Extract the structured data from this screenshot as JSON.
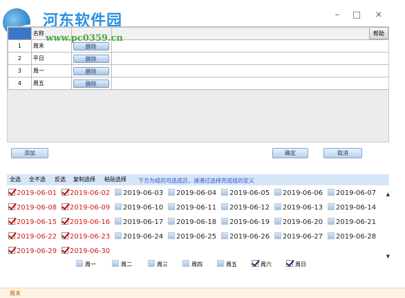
{
  "watermark": {
    "title": "河东软件园",
    "url": "www.pc0359.cn"
  },
  "window_controls": {
    "minimize": "–",
    "maximize": "□",
    "close": "×"
  },
  "grid": {
    "help_label": "帮助",
    "header": {
      "name": "名称"
    },
    "rows": [
      {
        "no": "1",
        "name": "周末",
        "action": "删除"
      },
      {
        "no": "2",
        "name": "平日",
        "action": "删除"
      },
      {
        "no": "3",
        "name": "周一",
        "action": "删除"
      },
      {
        "no": "4",
        "name": "周五",
        "action": "删除"
      }
    ]
  },
  "actions": {
    "add": "添加",
    "confirm": "确定",
    "cancel": "取消"
  },
  "toolbar": {
    "select_all": "全选",
    "select_none": "全不选",
    "invert": "反选",
    "copy_select": "复制选择",
    "paste_select": "粘贴选择",
    "hint": "下方为组的可选成员，请通过选择完成组的定义"
  },
  "dates": [
    {
      "label": "2019-06-01",
      "checked": true
    },
    {
      "label": "2019-06-02",
      "checked": true
    },
    {
      "label": "2019-06-03",
      "checked": false
    },
    {
      "label": "2019-06-04",
      "checked": false
    },
    {
      "label": "2019-06-05",
      "checked": false
    },
    {
      "label": "2019-06-06",
      "checked": false
    },
    {
      "label": "2019-06-07",
      "checked": false
    },
    {
      "label": "2019-06-08",
      "checked": true
    },
    {
      "label": "2019-06-09",
      "checked": true
    },
    {
      "label": "2019-06-10",
      "checked": false
    },
    {
      "label": "2019-06-11",
      "checked": false
    },
    {
      "label": "2019-06-12",
      "checked": false
    },
    {
      "label": "2019-06-13",
      "checked": false
    },
    {
      "label": "2019-06-14",
      "checked": false
    },
    {
      "label": "2019-06-15",
      "checked": true
    },
    {
      "label": "2019-06-16",
      "checked": true
    },
    {
      "label": "2019-06-17",
      "checked": false
    },
    {
      "label": "2019-06-18",
      "checked": false
    },
    {
      "label": "2019-06-19",
      "checked": false
    },
    {
      "label": "2019-06-20",
      "checked": false
    },
    {
      "label": "2019-06-21",
      "checked": false
    },
    {
      "label": "2019-06-22",
      "checked": true
    },
    {
      "label": "2019-06-23",
      "checked": true
    },
    {
      "label": "2019-06-24",
      "checked": false
    },
    {
      "label": "2019-06-25",
      "checked": false
    },
    {
      "label": "2019-06-26",
      "checked": false
    },
    {
      "label": "2019-06-27",
      "checked": false
    },
    {
      "label": "2019-06-28",
      "checked": false
    },
    {
      "label": "2019-06-29",
      "checked": true
    },
    {
      "label": "2019-06-30",
      "checked": true
    }
  ],
  "weekdays": [
    {
      "label": "周一",
      "checked": false
    },
    {
      "label": "周二",
      "checked": false
    },
    {
      "label": "周三",
      "checked": false
    },
    {
      "label": "周四",
      "checked": false
    },
    {
      "label": "周五",
      "checked": false
    },
    {
      "label": "周六",
      "checked": true
    },
    {
      "label": "周日",
      "checked": true
    }
  ],
  "status": {
    "text": "周末"
  }
}
